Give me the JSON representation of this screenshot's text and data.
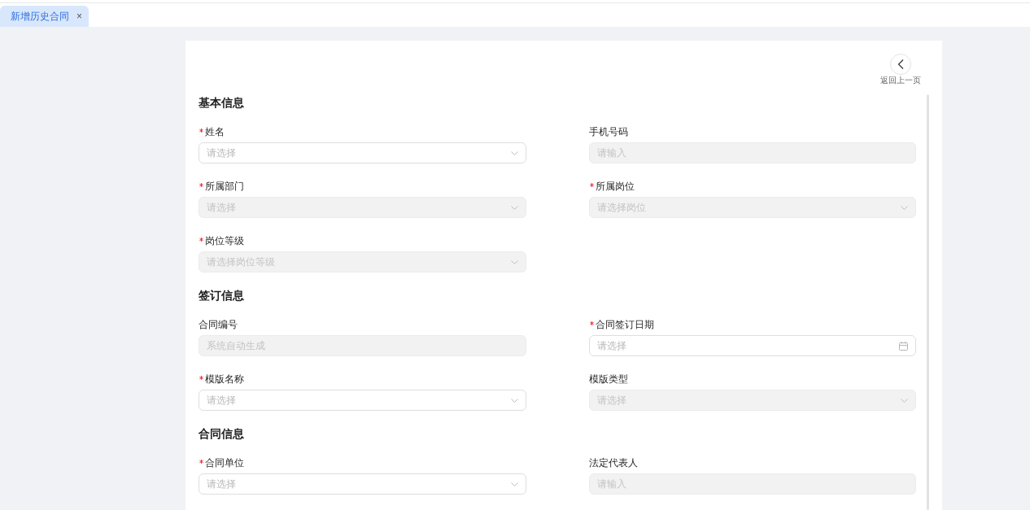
{
  "tabs": [
    {
      "label": "新增历史合同",
      "selected": true,
      "close": "×"
    }
  ],
  "back_button": {
    "label": "返回上一页"
  },
  "sections": [
    {
      "title": "基本信息",
      "fields": [
        {
          "label": "姓名",
          "required": true,
          "kind": "select",
          "placeholder": "请选择",
          "disabled": false
        },
        {
          "label": "手机号码",
          "required": false,
          "kind": "input",
          "placeholder": "请输入",
          "disabled": true
        },
        {
          "label": "所属部门",
          "required": true,
          "kind": "select",
          "placeholder": "请选择",
          "disabled": true
        },
        {
          "label": "所属岗位",
          "required": true,
          "kind": "select",
          "placeholder": "请选择岗位",
          "disabled": true
        },
        {
          "label": "岗位等级",
          "required": true,
          "kind": "select",
          "placeholder": "请选择岗位等级",
          "disabled": true
        }
      ]
    },
    {
      "title": "签订信息",
      "fields": [
        {
          "label": "合同编号",
          "required": false,
          "kind": "input",
          "placeholder": "系统自动生成",
          "disabled": true
        },
        {
          "label": "合同签订日期",
          "required": true,
          "kind": "date",
          "placeholder": "请选择",
          "disabled": false
        },
        {
          "label": "模版名称",
          "required": true,
          "kind": "select",
          "placeholder": "请选择",
          "disabled": false
        },
        {
          "label": "模版类型",
          "required": false,
          "kind": "select",
          "placeholder": "请选择",
          "disabled": true
        }
      ]
    },
    {
      "title": "合同信息",
      "fields": [
        {
          "label": "合同单位",
          "required": true,
          "kind": "select",
          "placeholder": "请选择",
          "disabled": false
        },
        {
          "label": "法定代表人",
          "required": false,
          "kind": "input",
          "placeholder": "请输入",
          "disabled": true
        }
      ]
    }
  ]
}
